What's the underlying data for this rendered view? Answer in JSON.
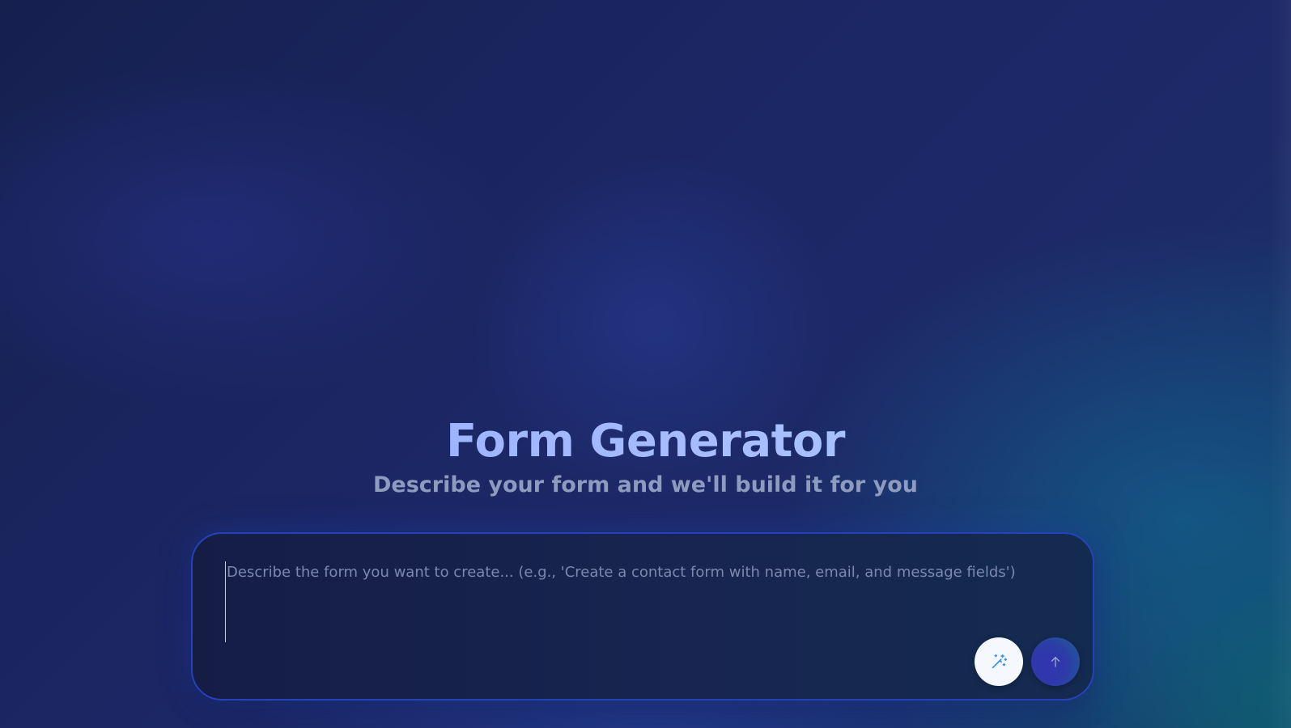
{
  "header": {
    "title": "Form Generator",
    "subtitle": "Describe your form and we'll build it for you"
  },
  "prompt": {
    "value": "",
    "placeholder": "Describe the form you want to create... (e.g., 'Create a contact form with name, email, and message fields')"
  },
  "actions": {
    "magic_icon": "magic-wand-icon",
    "send_icon": "arrow-up-icon"
  },
  "colors": {
    "title_gradient_start": "#8fa5ff",
    "title_gradient_end": "#a8d0ff",
    "subtitle": "#8d9bbf",
    "card_border": "#2642b8",
    "send_button": "#2d3aa8",
    "magic_icon": "#3a8ff0"
  }
}
